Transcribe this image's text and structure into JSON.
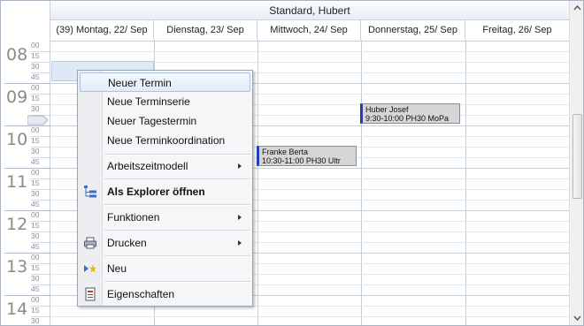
{
  "owner": "Standard, Hubert",
  "days": [
    "(39) Montag, 22/ Sep",
    "Dienstag, 23/ Sep",
    "Mittwoch, 24/ Sep",
    "Donnerstag, 25/ Sep",
    "Freitag, 26/ Sep"
  ],
  "hours": [
    "08",
    "09",
    "10",
    "11",
    "12",
    "13",
    "14"
  ],
  "minutes": [
    "00",
    "15",
    "30",
    "45"
  ],
  "appointments": [
    {
      "name": "Franke Berta",
      "detail": "10:30-11:00 PH30 Ultr"
    },
    {
      "name": "Huber Josef",
      "detail": "9:30-10:00 PH30 MoPa"
    }
  ],
  "menu": {
    "new_appointment": "Neuer Termin",
    "new_series": "Neue Terminserie",
    "new_day_appointment": "Neuer Tagestermin",
    "new_coordination": "Neue Terminkoordination",
    "work_time_model": "Arbeitszeitmodell",
    "open_explorer": "Als Explorer öffnen",
    "functions": "Funktionen",
    "print": "Drucken",
    "new": "Neu",
    "properties": "Eigenschaften"
  },
  "colors": {
    "selection": "#dfe8f7",
    "appointment_bar": "#1f3fbf",
    "appointment_bg": "#d6d6d6"
  }
}
